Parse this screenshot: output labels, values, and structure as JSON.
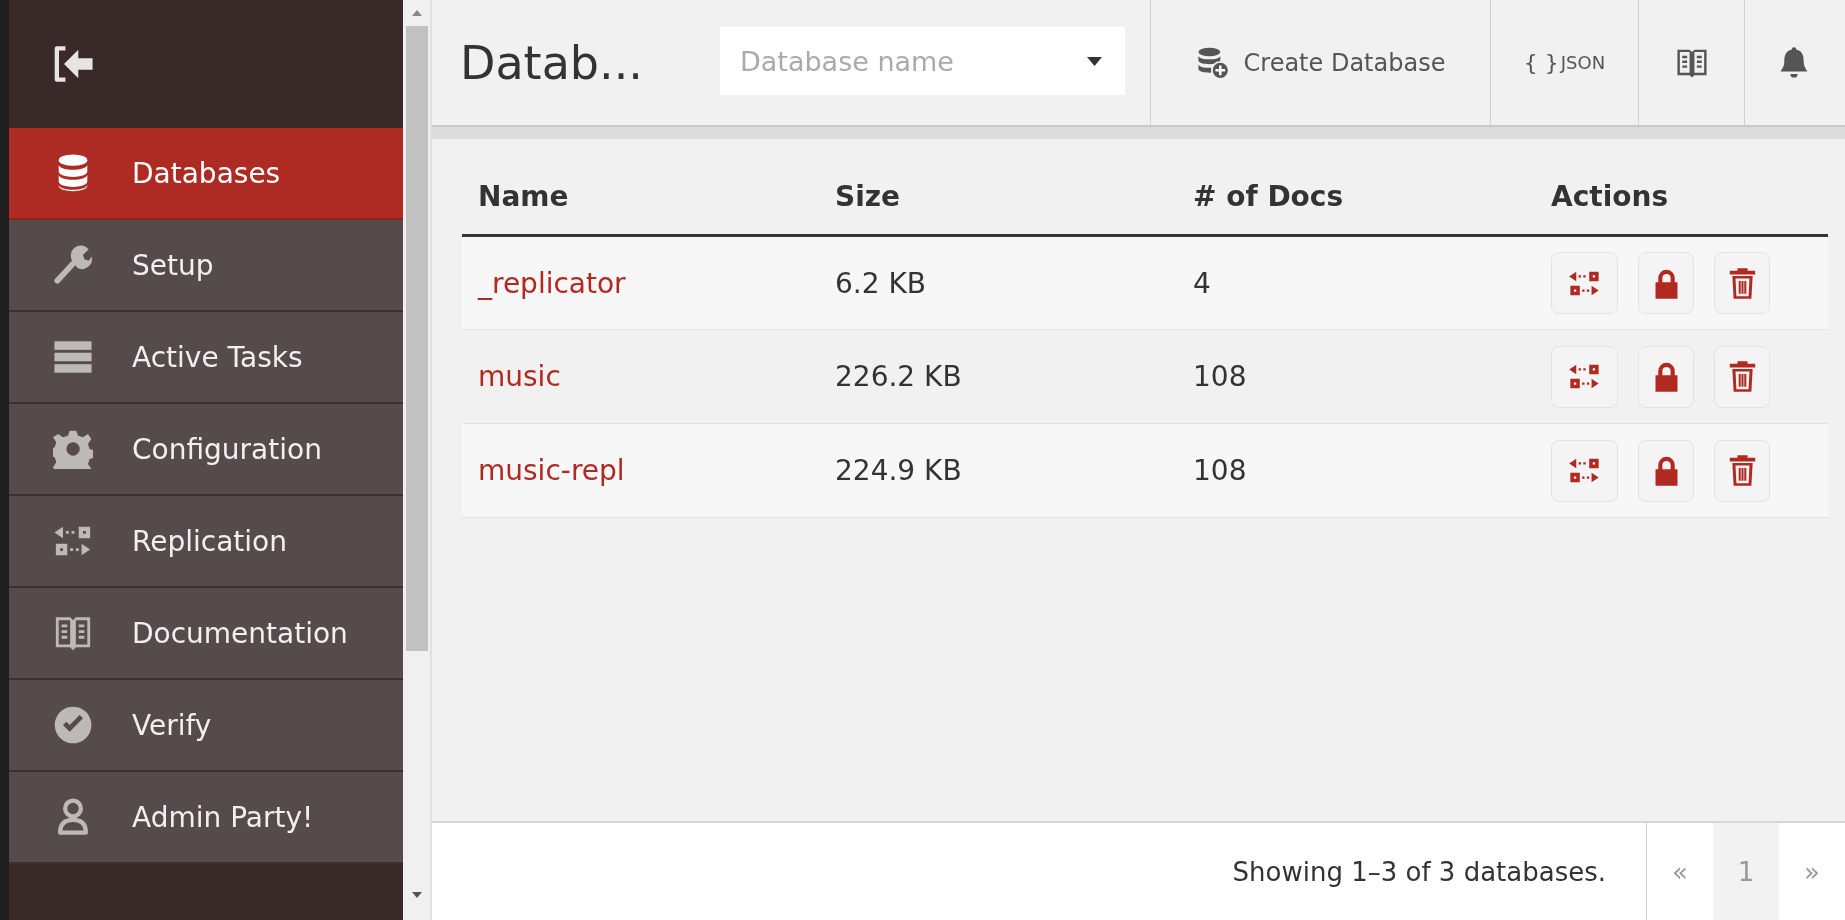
{
  "sidebar": {
    "items": [
      {
        "label": "Databases",
        "kind": "database",
        "selected": true
      },
      {
        "label": "Setup",
        "kind": "wrench",
        "selected": false
      },
      {
        "label": "Active Tasks",
        "kind": "tasks",
        "selected": false
      },
      {
        "label": "Configuration",
        "kind": "gear",
        "selected": false
      },
      {
        "label": "Replication",
        "kind": "replicate",
        "selected": false
      },
      {
        "label": "Documentation",
        "kind": "book",
        "selected": false
      },
      {
        "label": "Verify",
        "kind": "check",
        "selected": false
      },
      {
        "label": "Admin Party!",
        "kind": "user",
        "selected": false
      }
    ]
  },
  "header": {
    "title": "Datab...",
    "search": {
      "placeholder": "Database name"
    },
    "create_button": "Create Database",
    "json_button": {
      "icon": "{ }",
      "label": "JSON"
    }
  },
  "table": {
    "columns": [
      "Name",
      "Size",
      "# of Docs",
      "Actions"
    ],
    "rows": [
      {
        "name": "_replicator",
        "size": "6.2 KB",
        "docs": "4"
      },
      {
        "name": "music",
        "size": "226.2 KB",
        "docs": "108"
      },
      {
        "name": "music-repl",
        "size": "224.9 KB",
        "docs": "108"
      }
    ]
  },
  "footer": {
    "summary": "Showing 1–3 of 3 databases.",
    "pagination": [
      {
        "label": "«",
        "selected": false
      },
      {
        "label": "1",
        "selected": true
      },
      {
        "label": "»",
        "selected": false
      }
    ]
  }
}
